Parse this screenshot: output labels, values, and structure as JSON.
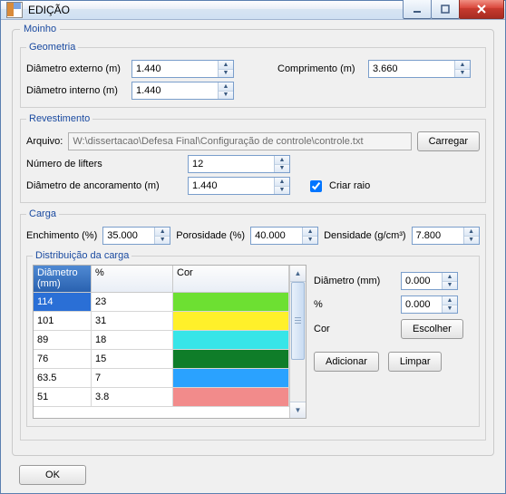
{
  "window": {
    "title": "EDIÇÃO"
  },
  "moinho": {
    "legend": "Moinho",
    "geometria": {
      "legend": "Geometria",
      "diam_ext_label": "Diâmetro externo (m)",
      "diam_ext": "1.440",
      "comprimento_label": "Comprimento (m)",
      "comprimento": "3.660",
      "diam_int_label": "Diâmetro interno (m)",
      "diam_int": "1.440"
    },
    "revestimento": {
      "legend": "Revestimento",
      "arquivo_label": "Arquivo:",
      "arquivo_path": "W:\\dissertacao\\Defesa Final\\Configuração de controle\\controle.txt",
      "carregar_label": "Carregar",
      "num_lifters_label": "Número de lifters",
      "num_lifters": "12",
      "diam_ancor_label": "Diâmetro de ancoramento (m)",
      "diam_ancor": "1.440",
      "criar_raio_label": "Criar raio",
      "criar_raio_checked": true
    },
    "carga": {
      "legend": "Carga",
      "enchimento_label": "Enchimento (%)",
      "enchimento": "35.000",
      "porosidade_label": "Porosidade (%)",
      "porosidade": "40.000",
      "densidade_label": "Densidade (g/cm³)",
      "densidade": "7.800",
      "dist_legend": "Distribuição da carga",
      "columns": {
        "diametro": "Diâmetro (mm)",
        "pct": "%",
        "cor": "Cor"
      },
      "rows": [
        {
          "diam": "114",
          "pct": "23",
          "color": "#6de032",
          "selected": true
        },
        {
          "diam": "101",
          "pct": "31",
          "color": "#fff02a",
          "selected": false
        },
        {
          "diam": "89",
          "pct": "18",
          "color": "#37e5e8",
          "selected": false
        },
        {
          "diam": "76",
          "pct": "15",
          "color": "#0f7d29",
          "selected": false
        },
        {
          "diam": "63.5",
          "pct": "7",
          "color": "#2aa2ff",
          "selected": false
        },
        {
          "diam": "51",
          "pct": "3.8",
          "color": "#f28b8b",
          "selected": false
        }
      ],
      "side": {
        "diam_label": "Diâmetro (mm)",
        "diam": "0.000",
        "pct_label": "%",
        "pct": "0.000",
        "cor_label": "Cor",
        "escolher_label": "Escolher",
        "adicionar_label": "Adicionar",
        "limpar_label": "Limpar"
      }
    }
  },
  "buttons": {
    "ok": "OK"
  }
}
